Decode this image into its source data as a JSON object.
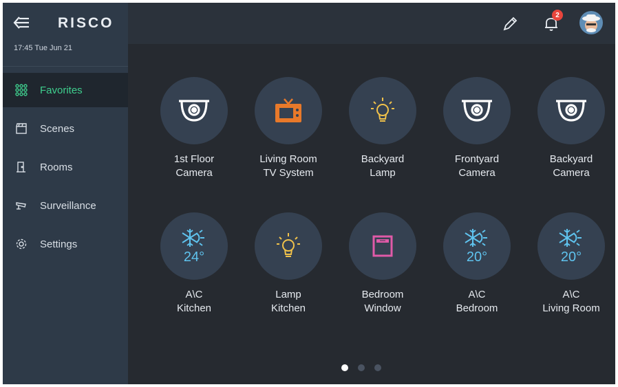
{
  "app": {
    "logo": "RISCO",
    "datetime": "17:45  Tue Jun 21"
  },
  "sidebar": {
    "items": [
      {
        "label": "Favorites",
        "icon": "grid-icon",
        "active": true
      },
      {
        "label": "Scenes",
        "icon": "clapperboard-icon"
      },
      {
        "label": "Rooms",
        "icon": "door-icon"
      },
      {
        "label": "Surveillance",
        "icon": "cctv-icon"
      },
      {
        "label": "Settings",
        "icon": "gear-icon"
      }
    ]
  },
  "topbar": {
    "notification_count": "2",
    "icons": [
      "pencil-icon",
      "bell-icon",
      "avatar"
    ]
  },
  "tiles": [
    {
      "line1": "1st Floor",
      "line2": "Camera",
      "icon": "dome-camera-icon"
    },
    {
      "line1": "Living Room",
      "line2": "TV System",
      "icon": "tv-icon"
    },
    {
      "line1": "Backyard",
      "line2": "Lamp",
      "icon": "bulb-icon"
    },
    {
      "line1": "Frontyard",
      "line2": "Camera",
      "icon": "dome-camera-icon"
    },
    {
      "line1": "Backyard",
      "line2": "Camera",
      "icon": "dome-camera-icon"
    },
    {
      "line1": "A\\C",
      "line2": "Kitchen",
      "icon": "snowflake-sun-icon",
      "temp": "24°"
    },
    {
      "line1": "Lamp",
      "line2": "Kitchen",
      "icon": "bulb-icon"
    },
    {
      "line1": "Bedroom",
      "line2": "Window",
      "icon": "window-icon"
    },
    {
      "line1": "A\\C",
      "line2": "Bedroom",
      "icon": "snowflake-sun-icon",
      "temp": "20°"
    },
    {
      "line1": "A\\C",
      "line2": "Living Room",
      "icon": "snowflake-sun-icon",
      "temp": "20°"
    }
  ],
  "pagination": {
    "pages": 3,
    "current": 1
  },
  "colors": {
    "accent": "#3fcf8e",
    "temp": "#5fc3ee",
    "tv": "#e8792a",
    "bulb": "#f1c24a",
    "window": "#e05aa8",
    "badge": "#e8453c"
  }
}
